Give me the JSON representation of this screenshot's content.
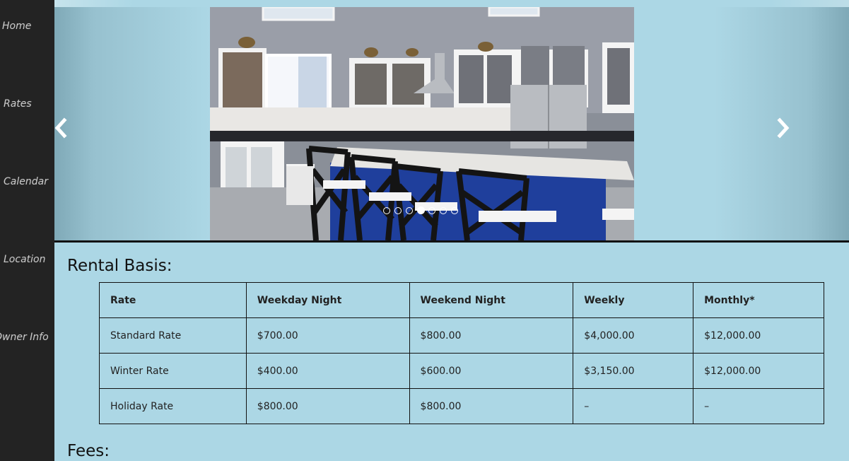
{
  "nav": {
    "home": "Home",
    "rates": "Rates",
    "calendar": "Calendar",
    "location": "Location",
    "owner_info": "Owner Info"
  },
  "slider": {
    "prev_icon": "chevron-left-icon",
    "next_icon": "chevron-right-icon",
    "slide_count": 7,
    "active_slide": 4,
    "image": "kitchen-photo"
  },
  "rental_basis": {
    "heading": "Rental Basis:",
    "columns": [
      "Rate",
      "Weekday Night",
      "Weekend Night",
      "Weekly",
      "Monthly*"
    ],
    "rows": [
      [
        "Standard Rate",
        "$700.00",
        "$800.00",
        "$4,000.00",
        "$12,000.00"
      ],
      [
        "Winter Rate",
        "$400.00",
        "$600.00",
        "$3,150.00",
        "$12,000.00"
      ],
      [
        "Holiday Rate",
        "$800.00",
        "$800.00",
        "–",
        "–"
      ]
    ]
  },
  "fees": {
    "heading": "Fees:"
  },
  "colors": {
    "page_bg": "#acd7e5",
    "sidebar_bg": "#232323",
    "nav_text": "#c9c9c9",
    "divider": "#111111"
  }
}
